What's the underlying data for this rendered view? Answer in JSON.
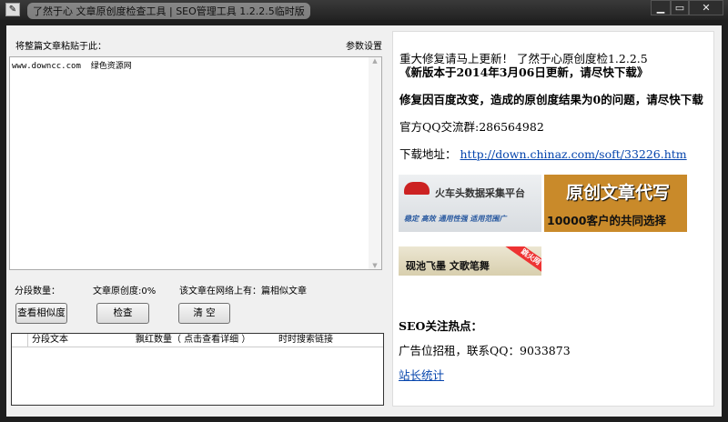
{
  "window": {
    "title": "了然于心 文章原创度检查工具 | SEO管理工具  1.2.2.5临时版",
    "minimize": "▁",
    "maximize": "▭",
    "close": "✕"
  },
  "left": {
    "paste_label": "将整篇文章粘贴于此：",
    "settings": "参数设置",
    "article_text": "www.downcc.com  绿色资源网",
    "segments_label": "分段数量：",
    "originality_label": "文章原创度:0%",
    "similar_label": "该文章在网络上有：",
    "similar_suffix": "篇相似文章",
    "buttons": {
      "view_similarity": "查看相似度",
      "check": "检查",
      "clear": "清 空"
    },
    "table_headers": [
      "分段文本",
      "飘红数量（ 点击查看详细 ）",
      "时时搜索链接"
    ]
  },
  "right": {
    "line1": "重大修复请马上更新！ 了然于心原创度检1.2.2.5",
    "line2": "《新版本于2014年3月06日更新，请尽快下载》",
    "line3": "修复因百度改变，造成的原创度结果为0的问题，请尽快下载",
    "qq_group": "官方QQ交流群:286564982",
    "download_label": "下载地址：",
    "download_url": "http://down.chinaz.com/soft/33226.htm",
    "ads": {
      "ad1_title": "火车头数据采集平台",
      "ad1_sub": "稳定 高效 通用性强 适用范围广",
      "ad2_title": "原创文章代写",
      "ad2_sub": "10000客户的共同选择",
      "ad3_title": "砚池飞墨 文歌笔舞",
      "ad3_ribbon": "跳火网"
    },
    "seo_heading": "SEO关注热点：",
    "ad_rent": "广告位招租，联系QQ：9033873",
    "stats_link": "站长统计"
  }
}
